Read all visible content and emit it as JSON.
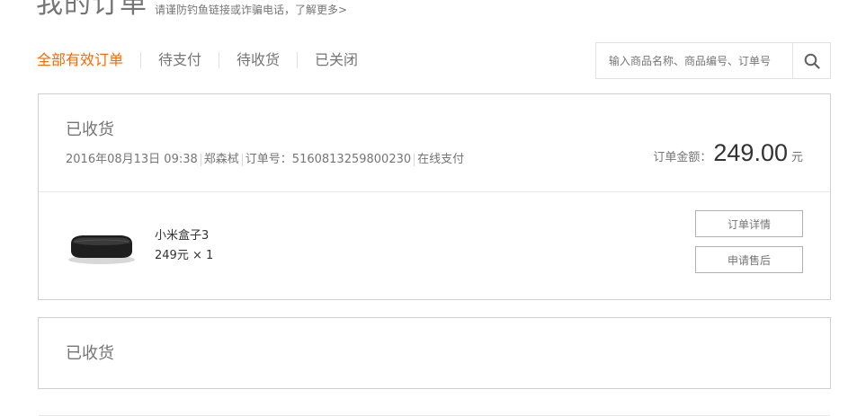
{
  "header": {
    "title": "我的订单",
    "subtitle": "请谨防钓鱼链接或诈骗电话，了解更多>"
  },
  "tabs": [
    {
      "label": "全部有效订单",
      "active": true
    },
    {
      "label": "待支付",
      "active": false
    },
    {
      "label": "待收货",
      "active": false
    },
    {
      "label": "已关闭",
      "active": false
    }
  ],
  "search": {
    "placeholder": "输入商品名称、商品编号、订单号",
    "icon": "search-icon"
  },
  "orders": [
    {
      "status": "已收货",
      "date": "2016年08月13日 09:38",
      "recipient": "郑森栻",
      "order_no_label": "订单号：",
      "order_no": "5160813259800230",
      "payment": "在线支付",
      "total_label": "订单金额：",
      "total_amount": "249.00",
      "total_unit": "元",
      "product": {
        "name": "小米盒子3",
        "price_qty": "249元 × 1"
      },
      "buttons": {
        "detail": "订单详情",
        "aftersale": "申请售后"
      }
    },
    {
      "status": "已收货"
    }
  ],
  "colors": {
    "accent": "#ff6700",
    "text_secondary": "#757575",
    "border": "#d0d0d0"
  }
}
